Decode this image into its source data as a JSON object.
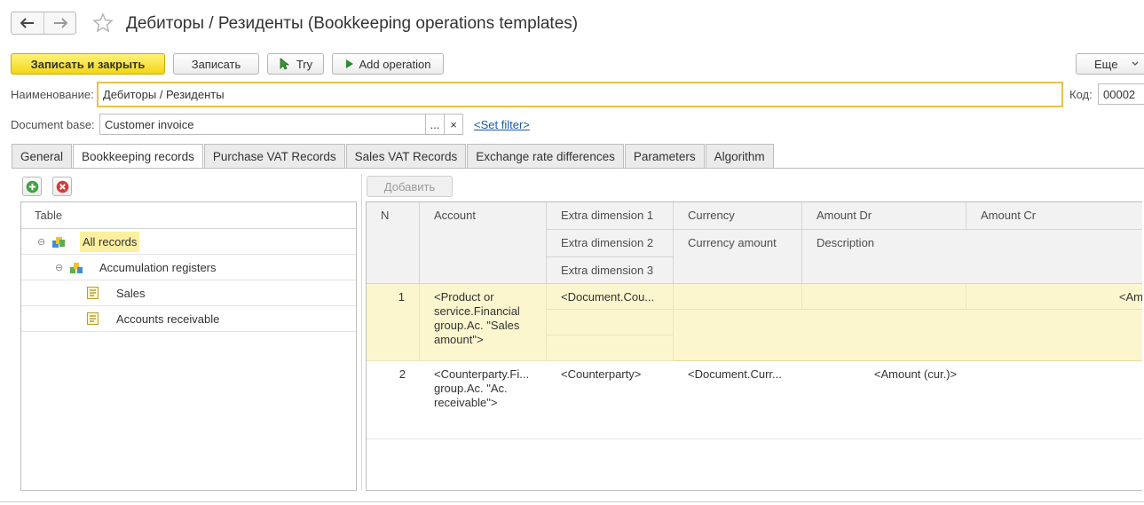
{
  "window": {
    "title": "Дебиторы / Резиденты (Bookkeeping operations templates)"
  },
  "toolbar": {
    "save_close": "Записать и закрыть",
    "save": "Записать",
    "try": "Try",
    "add_operation": "Add operation",
    "more": "Еще"
  },
  "form": {
    "name_label": "Наименование:",
    "name_value": "Дебиторы / Резиденты",
    "code_label": "Код:",
    "code_value": "00002",
    "docbase_label": "Document base:",
    "docbase_value": "Customer invoice",
    "choose_btn": "...",
    "clear_btn": "×",
    "set_filter": "<Set filter>"
  },
  "tabs": [
    "General",
    "Bookkeeping records",
    "Purchase VAT Records",
    "Sales VAT Records",
    "Exchange rate differences",
    "Parameters",
    "Algorithm"
  ],
  "tree": {
    "header": "Table",
    "items": [
      "All records",
      "Accumulation registers",
      "Sales",
      "Accounts receivable"
    ]
  },
  "grid": {
    "add_button": "Добавить",
    "headers": {
      "n": "N",
      "account": "Account",
      "extra1": "Extra dimension 1",
      "extra2": "Extra dimension 2",
      "extra3": "Extra dimension 3",
      "currency": "Currency",
      "currency_amount": "Currency amount",
      "amount_dr": "Amount Dr",
      "description": "Description",
      "amount_cr": "Amount Cr"
    },
    "rows": [
      {
        "n": "1",
        "account": "<Product or service.Financial group.Ac. \"Sales amount\">",
        "extra1": "<Document.Cou...",
        "amount_cr": "<Am"
      },
      {
        "n": "2",
        "account": "<Counterparty.Fi... group.Ac. \"Ac. receivable\">",
        "extra1": "<Counterparty>",
        "currency": "<Document.Curr...",
        "amount_dr": "<Amount (cur.)>"
      }
    ]
  },
  "colors": {
    "primary_button": "#f3d616",
    "selected_row": "#fcf6cf",
    "link": "#1b59a8",
    "focus_border": "#e8c247"
  }
}
